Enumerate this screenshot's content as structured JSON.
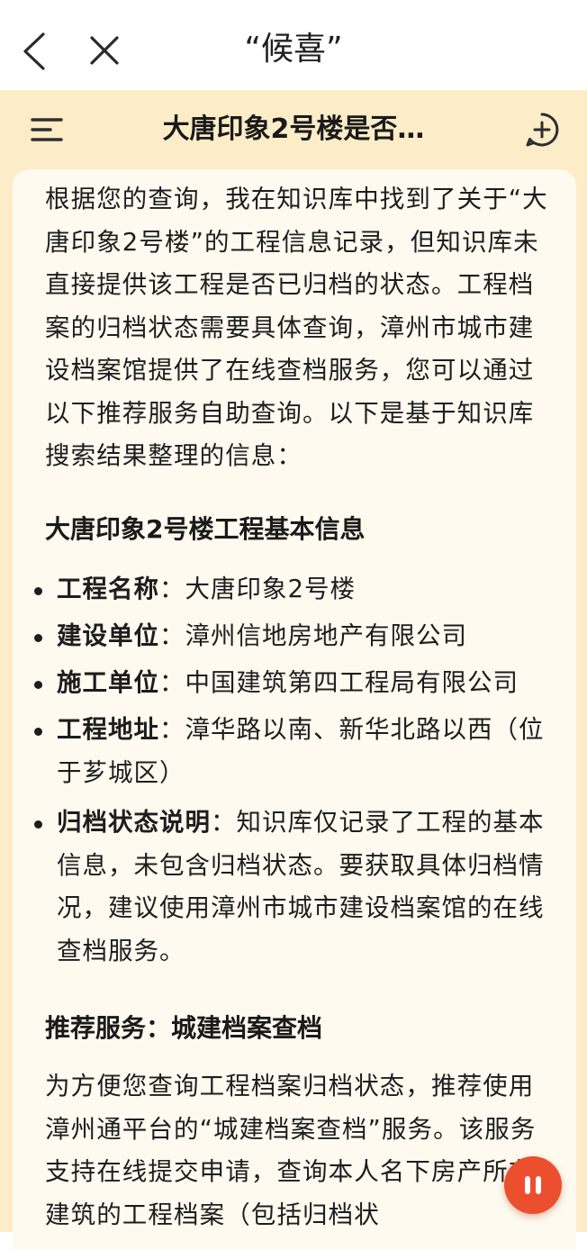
{
  "topbar": {
    "title": "“候喜”",
    "back_icon": "back-chevron-icon",
    "close_icon": "close-icon"
  },
  "chat": {
    "title": "大唐印象2号楼是否…",
    "menu_icon": "menu-icon",
    "new_chat_icon": "add-circle-icon",
    "intro": "根据您的查询，我在知识库中找到了关于“大唐印象2号楼”的工程信息记录，但知识库未直接提供该工程是否已归档的状态。工程档案的归档状态需要具体查询，漳州市城市建设档案馆提供了在线查档服务，您可以通过以下推荐服务自助查询。以下是基于知识库搜索结果整理的信息：",
    "section1_title": "大唐印象2号楼工程基本信息",
    "info_items": [
      {
        "label": "工程名称",
        "value": "：大唐印象2号楼"
      },
      {
        "label": "建设单位",
        "value": "：漳州信地房地产有限公司"
      },
      {
        "label": "施工单位",
        "value": "：中国建筑第四工程局有限公司"
      },
      {
        "label": "工程地址",
        "value": "：漳华路以南、新华北路以西（位于芗城区）"
      },
      {
        "label": "归档状态说明",
        "value": "：知识库仅记录了工程的基本信息，未包含归档状态。要获取具体归档情况，建议使用漳州市城市建设档案馆的在线查档服务。"
      }
    ],
    "section2_title": "推荐服务：城建档案查档",
    "service_text": "为方便您查询工程档案归档状态，推荐使用漳州通平台的“城建档案查档”服务。该服务支持在线提交申请，查询本人名下房产所在建筑的工程档案（包括归档状"
  },
  "controls": {
    "pause_icon": "pause-icon"
  },
  "colors": {
    "chat_background": "#fcecc8",
    "card_background": "#fefaf0",
    "accent": "#ec4f2e"
  }
}
